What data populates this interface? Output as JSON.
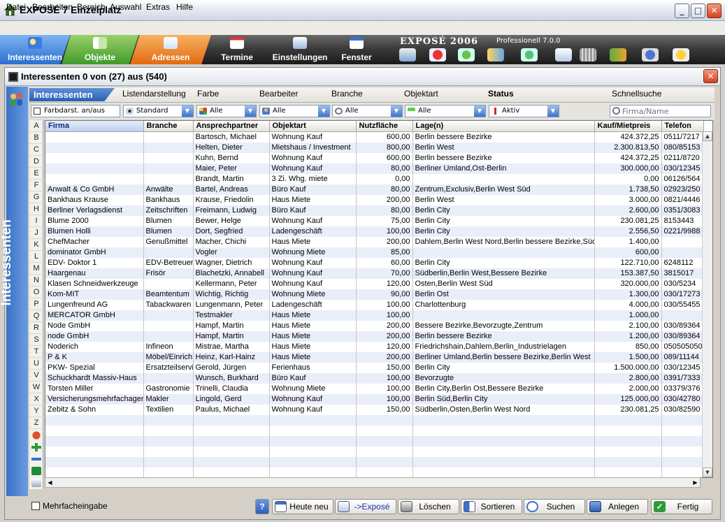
{
  "window": {
    "title": "EXPOSÉ 7 Einzelplatz",
    "min": "_",
    "max": "□",
    "close": "✕"
  },
  "menu": [
    "Datei",
    "Bearbeiten",
    "Bereich",
    "Auswahl",
    "Extras",
    "Hilfe"
  ],
  "nav": {
    "tabs": [
      "Interessenten",
      "Objekte",
      "Adressen",
      "Termine",
      "Einstellungen",
      "Fenster"
    ],
    "brand": "EXPOSÉ 2006",
    "edition": "Professionell 7.0.0"
  },
  "inner": {
    "title": "Interessenten  0 von (27) aus (540)",
    "side_label": "Interessenten",
    "close": "✕"
  },
  "filter": {
    "tab": "Interessenten",
    "headers": [
      "Listendarstellung",
      "Farbe",
      "Bearbeiter",
      "Branche",
      "Objektart",
      "Status",
      "Schnellsuche"
    ],
    "farbdarst": "Farbdarst. an/aus",
    "listendarstellung": "Standard",
    "farbe": "Alle",
    "bearbeiter": "Alle",
    "branche": "Alle",
    "objektart": "Alle",
    "status": "Aktiv",
    "search_placeholder": "Firma/Name"
  },
  "alphabet": [
    "A",
    "B",
    "C",
    "D",
    "E",
    "F",
    "G",
    "H",
    "I",
    "J",
    "K",
    "L",
    "M",
    "N",
    "O",
    "P",
    "Q",
    "R",
    "S",
    "T",
    "U",
    "V",
    "W",
    "X",
    "Y",
    "Z"
  ],
  "columns": [
    "Firma",
    "Branche",
    "Ansprechpartner",
    "Objektart",
    "Nutzfläche",
    "Lage(n)",
    "Kauf/Mietpreis",
    "Telefon"
  ],
  "rows": [
    [
      "",
      "",
      "Bartosch, Michael",
      "Wohnung Kauf",
      "600,00",
      "Berlin bessere Bezirke",
      "424.372,25",
      "0511/7217"
    ],
    [
      "",
      "",
      "Helten, Dieter",
      "Mietshaus / Investment",
      "800,00",
      "Berlin West",
      "2.300.813,50",
      "080/85153"
    ],
    [
      "",
      "",
      "Kuhn, Bernd",
      "Wohnung Kauf",
      "600,00",
      "Berlin bessere Bezirke",
      "424.372,25",
      "0211/8720"
    ],
    [
      "",
      "",
      "Maier, Peter",
      "Wohnung Kauf",
      "80,00",
      "Berliner Umland,Ost-Berlin",
      "300.000,00",
      "030/12345"
    ],
    [
      "",
      "",
      "Brandt, Martin",
      "3 Zi. Whg. miete",
      "0,00",
      "",
      "0,00",
      "06126/564"
    ],
    [
      "Anwalt & Co GmbH",
      "Anwälte",
      "Bartel, Andreas",
      "Büro Kauf",
      "80,00",
      "Zentrum,Exclusiv,Berlin West Süd",
      "1.738,50",
      "02923/250"
    ],
    [
      "Bankhaus Krause",
      "Bankhaus",
      "Krause, Friedolin",
      "Haus Miete",
      "200,00",
      "Berlin West",
      "3.000,00",
      "0821/4446"
    ],
    [
      "Berliner Verlagsdienst",
      "Zeitschriften",
      "Freimann, Ludwig",
      "Büro Kauf",
      "80,00",
      "Berlin City",
      "2.600,00",
      "0351/3083"
    ],
    [
      "Blume 2000",
      "Blumen",
      "Bewer, Helge",
      "Wohnung Kauf",
      "75,00",
      "Berlin City",
      "230.081,25",
      "8153443"
    ],
    [
      "Blumen Holli",
      "Blumen",
      "Dort, Segfried",
      "Ladengeschäft",
      "100,00",
      "Berlin City",
      "2.556,50",
      "0221/9988"
    ],
    [
      "ChefMacher",
      "Genußmittel",
      "Macher, Chichi",
      "Haus Miete",
      "200,00",
      "Dahlem,Berlin West Nord,Berlin bessere Bezirke,Süd",
      "1.400,00",
      ""
    ],
    [
      "dominator GmbH",
      "",
      "Vogler",
      "Wohnung Miete",
      "85,00",
      "",
      "600,00",
      ""
    ],
    [
      "EDV- Doktor 1",
      "EDV-Betreuer",
      "Wagner, Dietrich",
      "Wohnung Kauf",
      "60,00",
      "Berlin City",
      "122.710,00",
      "6248112"
    ],
    [
      "Haargenau",
      "Frisör",
      "Blachetzki, Annabell",
      "Wohnung Kauf",
      "70,00",
      "Südberlin,Berlin West,Bessere Bezirke",
      "153.387,50",
      "3815017"
    ],
    [
      "Klasen Schneidwerkzeuge",
      "",
      "Kellermann, Peter",
      "Wohnung Kauf",
      "120,00",
      "Osten,Berlin West Süd",
      "320.000,00",
      "030/5234"
    ],
    [
      "Kom-MIT",
      "Beamtentum",
      "Wichtig, Richtig",
      "Wohnung Miete",
      "90,00",
      "Berlin Ost",
      "1.300,00",
      "030/17273"
    ],
    [
      "Lungenfreund AG",
      "Tabackwaren",
      "Lungenmann, Peter",
      "Ladengeschäft",
      "100,00",
      "Charlottenburg",
      "4.000,00",
      "030/55455"
    ],
    [
      "MERCATOR GmbH",
      "",
      "Testmakler",
      "Haus Miete",
      "100,00",
      "",
      "1.000,00",
      ""
    ],
    [
      "Node GmbH",
      "",
      "Hampf, Martin",
      "Haus Miete",
      "200,00",
      "Bessere Bezirke,Bevorzugte,Zentrum",
      "2.100,00",
      "030/89364"
    ],
    [
      "node GmbH",
      "",
      "Hampf, Martin",
      "Haus Miete",
      "200,00",
      "Berlin bessere Bezirke",
      "1.200,00",
      "030/89364"
    ],
    [
      "Noderich",
      "Infineon",
      "Mistrae, Martha",
      "Haus Miete",
      "120,00",
      "Friedrichshain,Dahlem,Berlin_Industrielagen",
      "850,00",
      "050505050"
    ],
    [
      "P & K",
      "Möbel/Einrich",
      "Heinz, Karl-Hainz",
      "Haus Miete",
      "200,00",
      "Berliner Umland,Berlin bessere Bezirke,Berlin West",
      "1.500,00",
      "089/11144"
    ],
    [
      "PKW- Spezial",
      "Ersatzteilservic",
      "Gerold, Jürgen",
      "Ferienhaus",
      "150,00",
      "Berlin City",
      "1.500.000,00",
      "030/12345"
    ],
    [
      "Schuckhardt Massiv-Haus",
      "",
      "Wunsch, Burkhard",
      "Büro Kauf",
      "100,00",
      "Bevorzugte",
      "2.800,00",
      "0391/7333"
    ],
    [
      "Torsten Miller",
      "Gastronomie",
      "Trinelli, Claudia",
      "Wohnung Miete",
      "100,00",
      "Berlin City,Berlin Ost,Bessere Bezirke",
      "2.000,00",
      "03379/376"
    ],
    [
      "Versicherungsmehrfachagen",
      "Makler",
      "Lingold, Gerd",
      "Wohnung Kauf",
      "100,00",
      "Berlin Süd,Berlin City",
      "125.000,00",
      "030/42780"
    ],
    [
      "Zebitz & Sohn",
      "Textilien",
      "Paulus, Michael",
      "Wohnung Kauf",
      "150,00",
      "Südberlin,Osten,Berlin West Nord",
      "230.081,25",
      "030/82590"
    ]
  ],
  "empty_rows": 7,
  "footer": {
    "mehrfach": "Mehrfacheingabe",
    "help": "?",
    "buttons": [
      "Heute neu",
      "->Exposé",
      "Löschen",
      "Sortieren",
      "Suchen",
      "Anlegen",
      "Fertig"
    ]
  },
  "colors": {
    "accent_blue": "#2c5fb2",
    "objekte_green": "#3f9a2a",
    "adressen_orange": "#e26b10",
    "row_alt": "#e9eef8"
  }
}
